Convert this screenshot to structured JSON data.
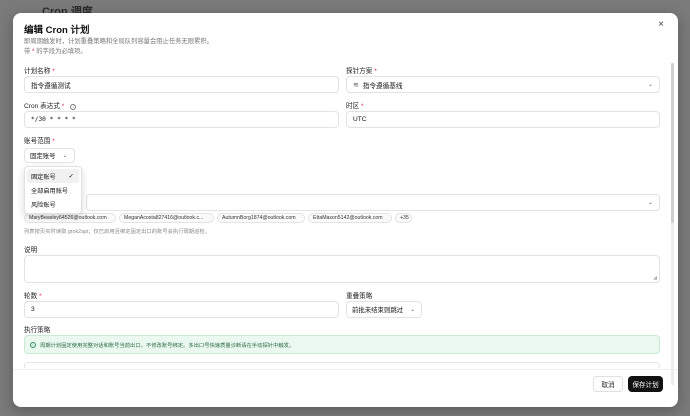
{
  "background": {
    "page_title": "Cron 调度"
  },
  "modal": {
    "title": "编辑 Cron 计划",
    "description": "即周期触发时，计划重叠策略和全局队列容量会阻止任务无限累积。",
    "required_note_prefix": "带",
    "required_star": "*",
    "required_note_suffix": "的字段为必填项。",
    "close_glyph": "×"
  },
  "form": {
    "plan_name": {
      "label": "计划名称",
      "value": "指令遵循测试"
    },
    "probe_scheme": {
      "label": "探针方案",
      "value": "指令遵循基线"
    },
    "cron": {
      "label": "Cron 表达式",
      "value": "*/30 * * * *"
    },
    "timezone": {
      "label": "时区",
      "value": "UTC"
    },
    "account_scope": {
      "label": "账号范围",
      "value": "固定账号",
      "options": [
        "固定账号",
        "全部启用账号",
        "风险账号"
      ],
      "selected_index": 0
    },
    "accounts": {
      "chips": [
        "MaryBeasley64526@outlook.com",
        "MeganAcosta827416@outlook.c...",
        "AutumnBorg1874@outlook.com",
        "EttaMason5142@outlook.com"
      ],
      "more": "+35",
      "hint": "列表按页实时读取 grok2api；仅已启用且绑定固定出口的账号会执行周期巡检。"
    },
    "description": {
      "label": "说明",
      "value": ""
    },
    "rounds": {
      "label": "轮数",
      "value": "3"
    },
    "overlap": {
      "label": "重叠策略",
      "value": "前批未结束则跳过"
    },
    "exec_strategy": {
      "label": "执行策略",
      "info": "周期计划固定使用完整对话和账号当前出口，不修改账号绑定。多出口号快速质量诊断请在手动探针中触发。"
    }
  },
  "footer": {
    "cancel": "取消",
    "save": "保存计划"
  },
  "icons": [
    "close-icon",
    "layers-icon",
    "info-icon",
    "chevron-down-icon",
    "check-icon",
    "resize-handle-icon"
  ],
  "colors": {
    "required": "#e11d48",
    "primary_button": "#111111",
    "banner_bg": "#eaf8ef"
  }
}
